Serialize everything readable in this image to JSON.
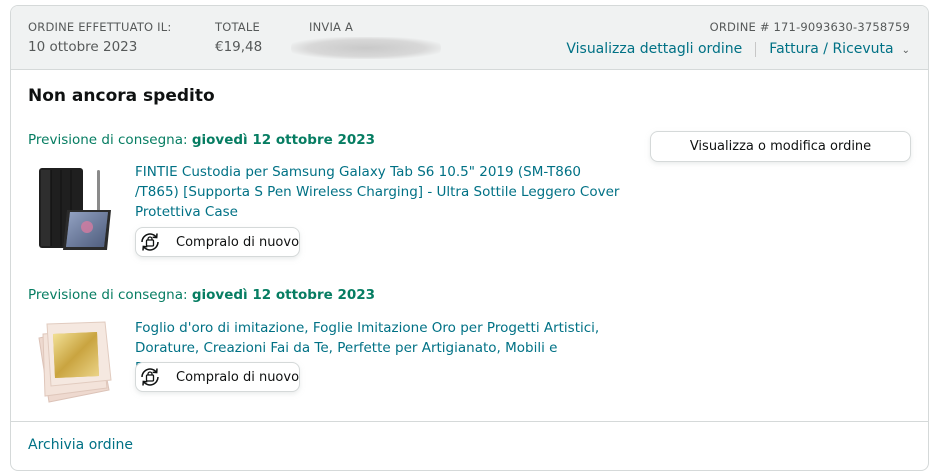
{
  "header": {
    "order_placed_label": "ORDINE EFFETTUATO IL:",
    "order_placed_value": "10 ottobre 2023",
    "total_label": "TOTALE",
    "total_value": "€19,48",
    "ship_to_label": "INVIA A",
    "order_number": "ORDINE # 171-9093630-3758759",
    "details_link": "Visualizza dettagli ordine",
    "invoice_link": "Fattura / Ricevuta"
  },
  "status": "Non ancora spedito",
  "items": [
    {
      "delivery_label": "Previsione di consegna:",
      "delivery_date": "giovedì 12 ottobre 2023",
      "title": "FINTIE Custodia per Samsung Galaxy Tab S6 10.5\" 2019 (SM-T860 /T865) [Supporta S Pen Wireless Charging] - Ultra Sottile Leggero Cover Protettiva Case",
      "buy_again": "Compralo di nuovo"
    },
    {
      "delivery_label": "Previsione di consegna:",
      "delivery_date": "giovedì 12 ottobre 2023",
      "title": "Foglio d'oro di imitazione, Foglie Imitazione Oro per Progetti Artistici, Dorature, Creazioni Fai da Te, Perfette per Artigianato, Mobili e Decorazione",
      "buy_again": "Compralo di nuovo"
    }
  ],
  "actions": {
    "view_edit": "Visualizza o modifica ordine",
    "archive": "Archivia ordine"
  },
  "colors": {
    "link": "#007185",
    "delivery": "#067d62",
    "header_bg": "#f0f2f2",
    "border": "#d5d9d9"
  }
}
